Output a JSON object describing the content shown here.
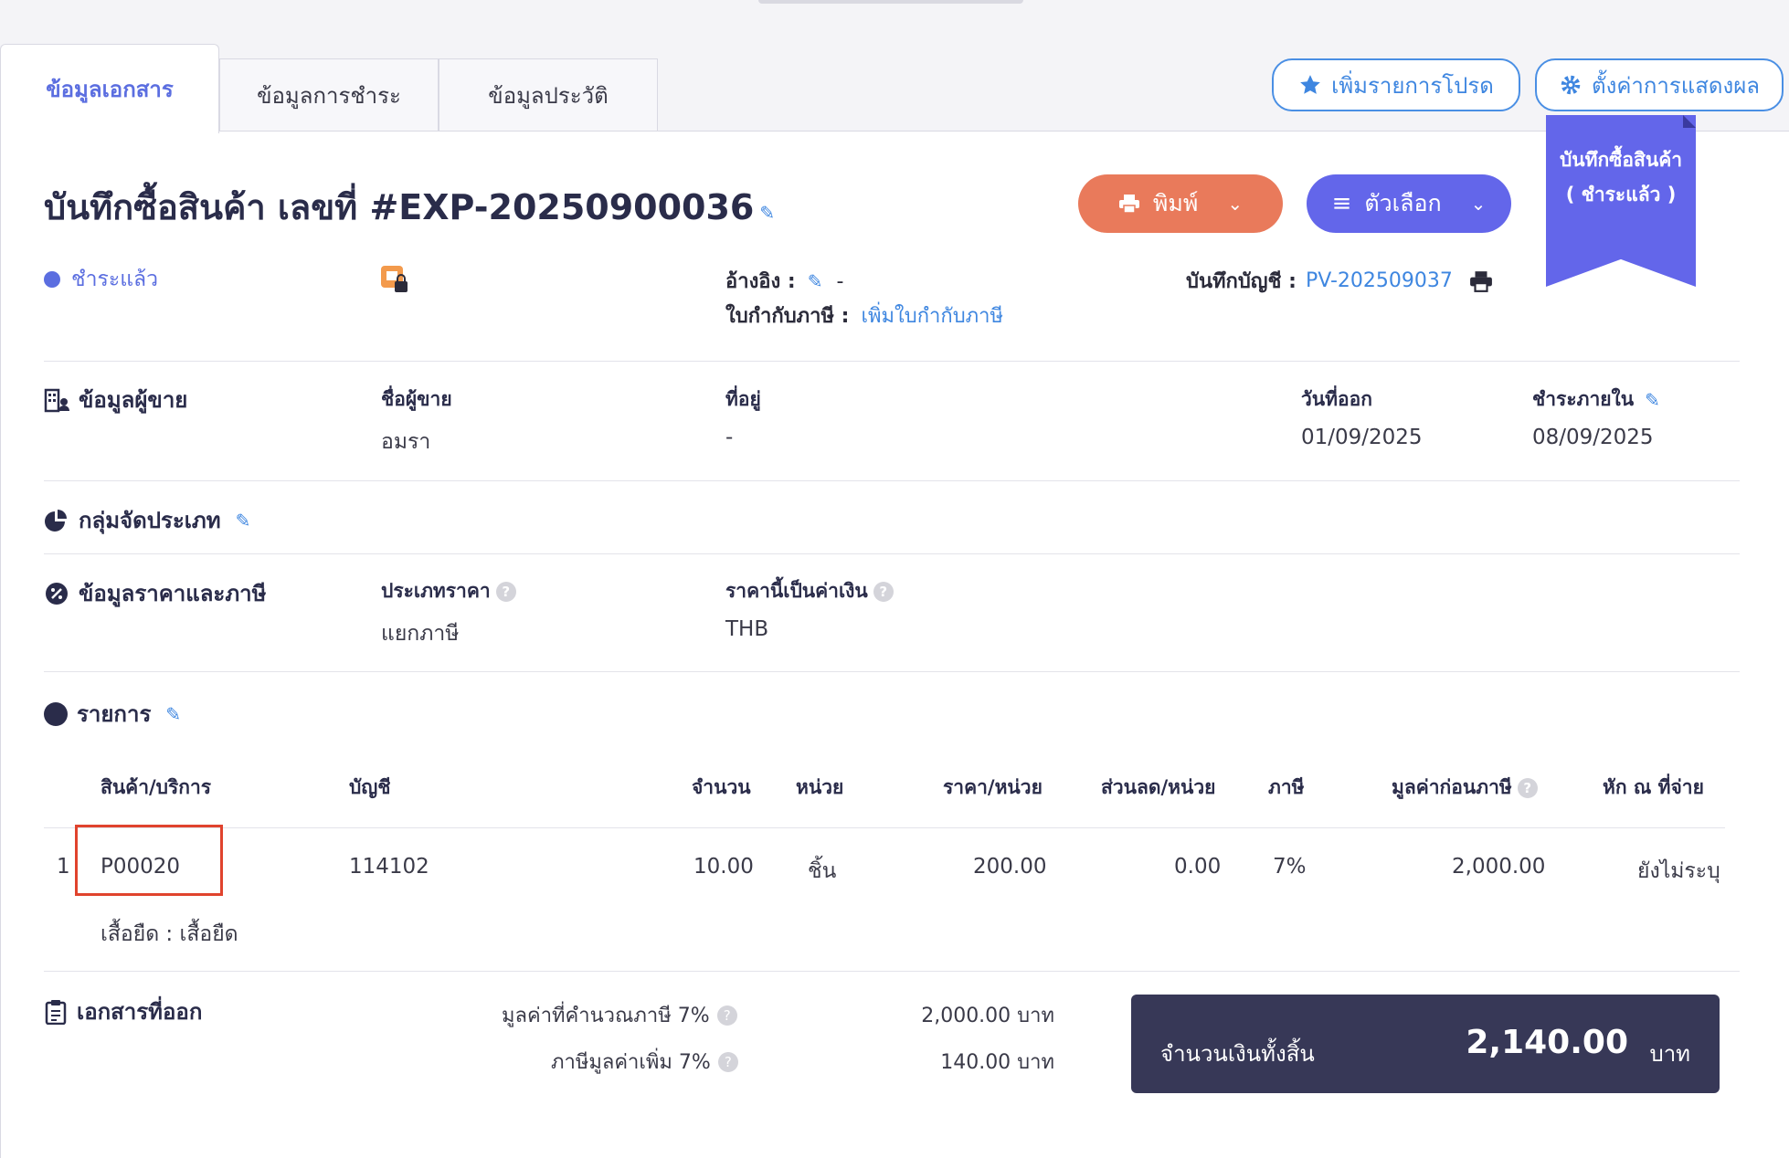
{
  "tabs": [
    {
      "label": "ข้อมูลเอกสาร"
    },
    {
      "label": "ข้อมูลการชำระ"
    },
    {
      "label": "ข้อมูลประวัติ"
    }
  ],
  "top_actions": {
    "favorite_label": "เพิ่มรายการโปรด",
    "display_settings_label": "ตั้งค่าการแสดงผล"
  },
  "ribbon": {
    "line1": "บันทึกซื้อสินค้า",
    "line2": "( ชำระแล้ว )"
  },
  "document": {
    "title": "บันทึกซื้อสินค้า เลขที่ #EXP-20250900036",
    "status": "ชำระแล้ว",
    "reference_label": "อ้างอิง :",
    "reference_value": "-",
    "tax_invoice_label": "ใบกำกับภาษี :",
    "tax_invoice_link": "เพิ่มใบกำกับภาษี",
    "account_record_label": "บันทึกบัญชี :",
    "account_record_value": "PV-202509037"
  },
  "buttons": {
    "print_label": "พิมพ์",
    "options_label": "ตัวเลือก"
  },
  "vendor_section": {
    "title": "ข้อมูลผู้ขาย",
    "name_label": "ชื่อผู้ขาย",
    "name_value": "อมรา",
    "address_label": "ที่อยู่",
    "address_value": "-",
    "issue_date_label": "วันที่ออก",
    "issue_date_value": "01/09/2025",
    "due_label": "ชำระภายใน",
    "due_value": "08/09/2025"
  },
  "category_section": {
    "title": "กลุ่มจัดประเภท"
  },
  "price_tax_section": {
    "title": "ข้อมูลราคาและภาษี",
    "price_type_label": "ประเภทราคา",
    "price_type_value": "แยกภาษี",
    "currency_label": "ราคานี้เป็นค่าเงิน",
    "currency_value": "THB"
  },
  "items_section": {
    "title": "รายการ",
    "columns": {
      "product": "สินค้า/บริการ",
      "account": "บัญชี",
      "qty": "จำนวน",
      "unit": "หน่วย",
      "price": "ราคา/หน่วย",
      "discount": "ส่วนลด/หน่วย",
      "tax": "ภาษี",
      "pretax": "มูลค่าก่อนภาษี",
      "withholding": "หัก ณ ที่จ่าย"
    },
    "rows": [
      {
        "no": "1",
        "product": "P00020",
        "account": "114102",
        "qty": "10.00",
        "unit": "ชิ้น",
        "price": "200.00",
        "discount": "0.00",
        "tax": "7%",
        "pretax": "2,000.00",
        "withholding": "ยังไม่ระบุ",
        "description": "เสื้อยืด : เสื้อยืด"
      }
    ]
  },
  "issued_docs_section": {
    "title": "เอกสารที่ออก"
  },
  "summary": {
    "taxable_label": "มูลค่าที่คำนวณภาษี 7%",
    "taxable_value": "2,000.00 บาท",
    "vat_label": "ภาษีมูลค่าเพิ่ม 7%",
    "vat_value": "140.00 บาท",
    "total_label": "จำนวนเงินทั้งสิ้น",
    "total_value": "2,140.00",
    "total_unit": "บาท"
  },
  "colors": {
    "accent": "#5b6ee0",
    "print": "#e97a5b",
    "options": "#6366ea",
    "total_bg": "#373857",
    "highlight": "#e0432d"
  }
}
